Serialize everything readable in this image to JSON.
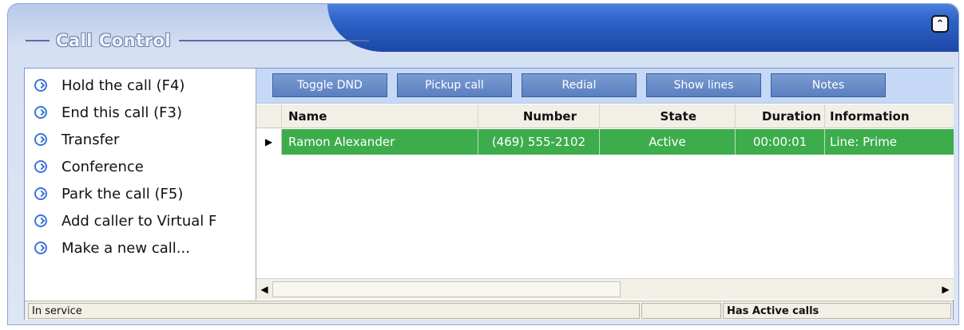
{
  "panel": {
    "title": "Call Control",
    "collapse_icon": "double-chevron-up-icon"
  },
  "actions": [
    {
      "label": "Hold the call (F4)",
      "icon": "hold-icon"
    },
    {
      "label": "End this call (F3)",
      "icon": "end-call-icon"
    },
    {
      "label": "Transfer",
      "icon": "transfer-icon"
    },
    {
      "label": "Conference",
      "icon": "conference-icon"
    },
    {
      "label": "Park the call (F5)",
      "icon": "park-icon"
    },
    {
      "label": "Add caller to Virtual F",
      "icon": "virtual-icon"
    },
    {
      "label": "Make a new call...",
      "icon": "new-call-icon"
    }
  ],
  "toolbar": {
    "toggle_dnd": "Toggle DND",
    "pickup_call": "Pickup call",
    "redial": "Redial",
    "show_lines": "Show lines",
    "notes": "Notes"
  },
  "grid": {
    "columns": [
      "Name",
      "Number",
      "State",
      "Duration",
      "Information"
    ],
    "rows": [
      {
        "name": "Ramon Alexander",
        "number": "(469) 555-2102",
        "state": "Active",
        "duration": "00:00:01",
        "information": "Line: Prime"
      }
    ],
    "selected_row_color": "#3dad4c"
  },
  "status": {
    "left": "In service",
    "middle": "",
    "right": "Has Active calls"
  }
}
